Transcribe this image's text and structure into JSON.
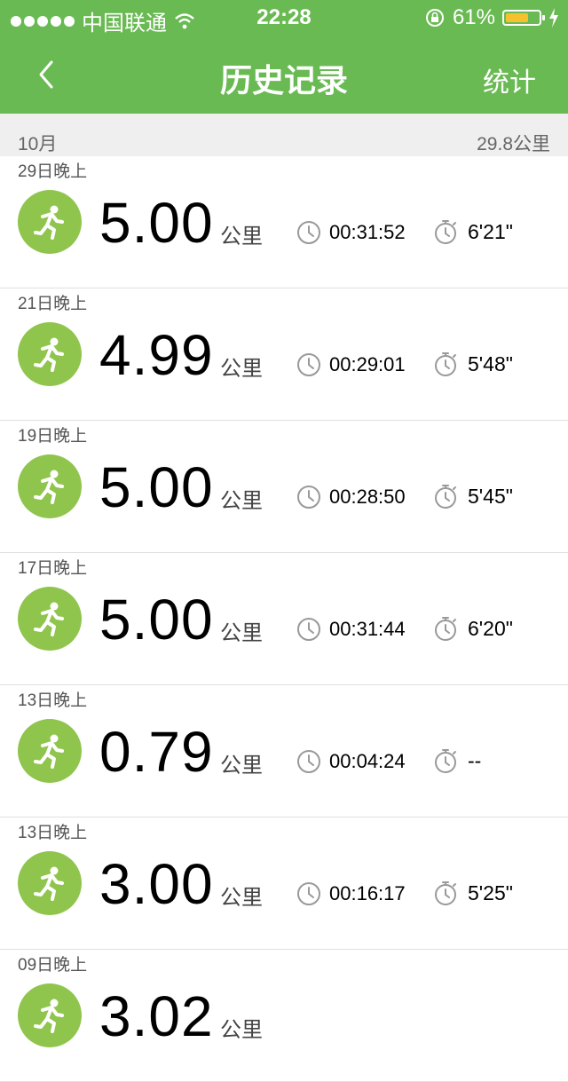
{
  "status_bar": {
    "carrier": "中国联通",
    "time": "22:28",
    "battery_percent": "61%",
    "battery_level": 0.61,
    "battery_color": "#f6c12c"
  },
  "nav": {
    "title": "历史记录",
    "back_icon": "chevron-left-icon",
    "stats_label": "统计"
  },
  "month_header": {
    "month": "10月",
    "total": "29.8公里"
  },
  "records": [
    {
      "date": "29日晚上",
      "distance": "5.00",
      "unit": "公里",
      "duration": "00:31:52",
      "pace": "6'21\""
    },
    {
      "date": "21日晚上",
      "distance": "4.99",
      "unit": "公里",
      "duration": "00:29:01",
      "pace": "5'48\""
    },
    {
      "date": "19日晚上",
      "distance": "5.00",
      "unit": "公里",
      "duration": "00:28:50",
      "pace": "5'45\""
    },
    {
      "date": "17日晚上",
      "distance": "5.00",
      "unit": "公里",
      "duration": "00:31:44",
      "pace": "6'20\""
    },
    {
      "date": "13日晚上",
      "distance": "0.79",
      "unit": "公里",
      "duration": "00:04:24",
      "pace": "--"
    },
    {
      "date": "13日晚上",
      "distance": "3.00",
      "unit": "公里",
      "duration": "00:16:17",
      "pace": "5'25\""
    },
    {
      "date": "09日晚上",
      "distance": "3.02",
      "unit": "公里",
      "duration": "",
      "pace": ""
    }
  ],
  "colors": {
    "accent": "#6aba54",
    "run_icon_bg": "#8fc54d"
  }
}
